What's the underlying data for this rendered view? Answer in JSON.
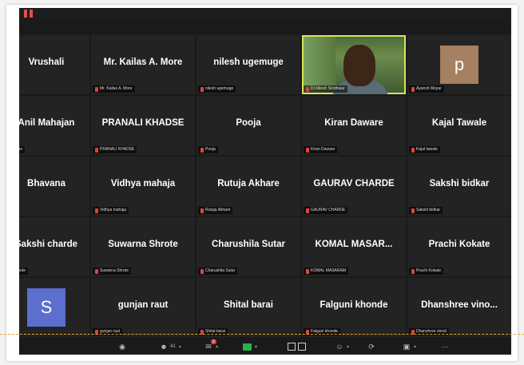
{
  "meeting": {
    "tiles": [
      {
        "name": "Vrushali",
        "label": "shali",
        "type": "name"
      },
      {
        "name": "Mr. Kailas A. More",
        "label": "Mr. Kailas A. More",
        "type": "name"
      },
      {
        "name": "nilesh ugemuge",
        "label": "nilesh ugemuge",
        "type": "name"
      },
      {
        "name": "",
        "label": "Dr.Nilesh Sindhwar",
        "type": "video"
      },
      {
        "name": "p",
        "label": "Ayansh Moyar",
        "type": "avatar",
        "avatar_color": "#a58061"
      },
      {
        "name": "Anil Mahajan",
        "label": "Mahajan",
        "type": "name"
      },
      {
        "name": "PRANALI KHADSE",
        "label": "PRANALI KHADSE",
        "type": "name"
      },
      {
        "name": "Pooja",
        "label": "Pooja",
        "type": "name"
      },
      {
        "name": "Kiran Daware",
        "label": "Kiran Daware",
        "type": "name"
      },
      {
        "name": "Kajal Tawale",
        "label": "Kajal tawale",
        "type": "name"
      },
      {
        "name": "Bhavana",
        "label": "vana",
        "type": "name"
      },
      {
        "name": "Vidhya mahaja",
        "label": "Vidhya mahaja",
        "type": "name"
      },
      {
        "name": "Rutuja Akhare",
        "label": "Rutuja Akhare",
        "type": "name"
      },
      {
        "name": "GAURAV CHARDE",
        "label": "GAURAV CHARDE",
        "type": "name"
      },
      {
        "name": "Sakshi  bidkar",
        "label": "Sakshi  bidkar",
        "type": "name"
      },
      {
        "name": "Sakshi charde",
        "label": "shi charde",
        "type": "name"
      },
      {
        "name": "Suwarna Shrote",
        "label": "Suwarna Shrote",
        "type": "name"
      },
      {
        "name": "Charushila Sutar",
        "label": "Charushila Sutar",
        "type": "name"
      },
      {
        "name": "KOMAL  MASAR...",
        "label": "KOMAL MASARAM",
        "type": "name"
      },
      {
        "name": "Prachi Kokate",
        "label": "Prachi Kokate",
        "type": "name"
      },
      {
        "name": "S",
        "label": "",
        "type": "avatar",
        "avatar_color": "#5b6fcf"
      },
      {
        "name": "gunjan raut",
        "label": "gunjan raut",
        "type": "name"
      },
      {
        "name": "Shital barai",
        "label": "Shital barai",
        "type": "name"
      },
      {
        "name": "Falguni khonde",
        "label": "Falguni khonde",
        "type": "name"
      },
      {
        "name": "Dhanshree  vino...",
        "label": "Dhanshree vinod",
        "type": "name"
      }
    ],
    "active_tile_index": 3
  },
  "toolbar": {
    "participants_count": "41",
    "chat_badge": "2"
  },
  "colors": {
    "tile_bg": "#232323",
    "window_bg": "#1a1a1a",
    "active_outline": "#d9e25a",
    "mute_red": "#e0443a",
    "share_green": "#27b24a"
  }
}
